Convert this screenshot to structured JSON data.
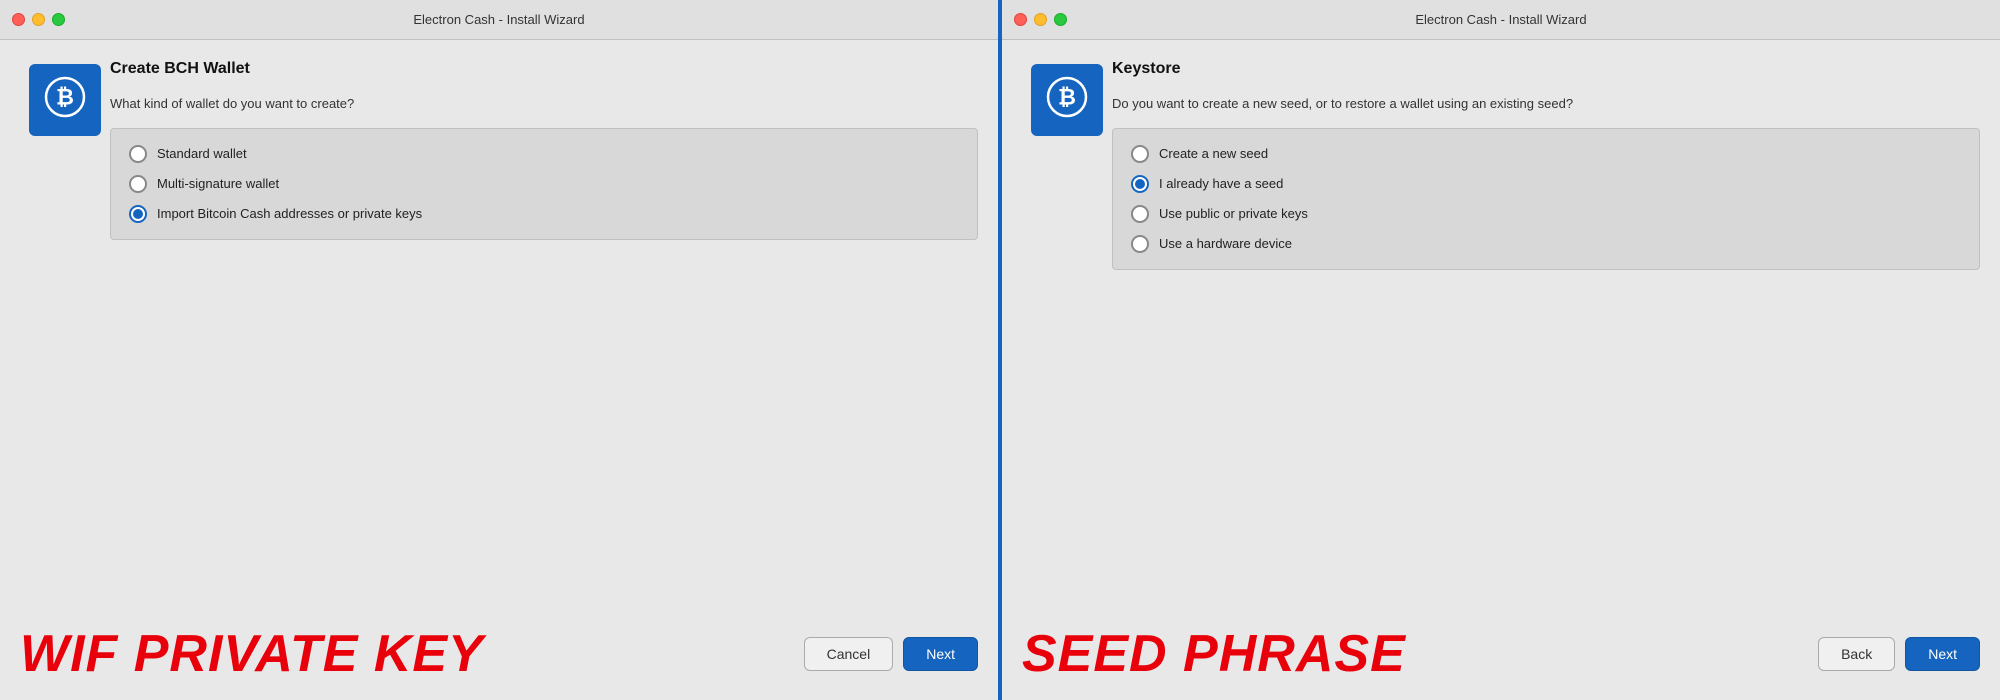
{
  "left": {
    "titlebar": {
      "text": "Electron Cash  -  Install Wizard"
    },
    "logo": {
      "symbol": "₿"
    },
    "content": {
      "title": "Create BCH Wallet",
      "description": "What kind of wallet do you want to create?",
      "options": [
        {
          "id": "standard",
          "label": "Standard wallet",
          "selected": false
        },
        {
          "id": "multisig",
          "label": "Multi-signature wallet",
          "selected": false
        },
        {
          "id": "import",
          "label": "Import Bitcoin Cash addresses or private keys",
          "selected": true
        }
      ]
    },
    "footer": {
      "label": "WIF PRIVATE KEY",
      "cancel_btn": "Cancel",
      "next_btn": "Next"
    }
  },
  "right": {
    "titlebar": {
      "text": "Electron Cash  -  Install Wizard"
    },
    "logo": {
      "symbol": "₿"
    },
    "content": {
      "title": "Keystore",
      "description": "Do you want to create a new seed, or to restore a wallet using an existing seed?",
      "options": [
        {
          "id": "new-seed",
          "label": "Create a new seed",
          "selected": false
        },
        {
          "id": "have-seed",
          "label": "I already have a seed",
          "selected": true
        },
        {
          "id": "pub-priv-keys",
          "label": "Use public or private keys",
          "selected": false
        },
        {
          "id": "hardware",
          "label": "Use a hardware device",
          "selected": false
        }
      ]
    },
    "footer": {
      "label": "SEED PHRASE",
      "back_btn": "Back",
      "next_btn": "Next"
    }
  }
}
